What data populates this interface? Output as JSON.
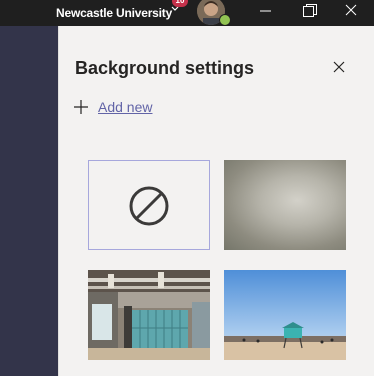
{
  "titlebar": {
    "org_name": "Newcastle University",
    "notification_count": "10",
    "presence_status": "available"
  },
  "panel": {
    "title": "Background settings",
    "add_new_label": "Add new"
  },
  "backgrounds": [
    {
      "name": "None"
    },
    {
      "name": "Blur"
    },
    {
      "name": "Office corridor"
    },
    {
      "name": "Beach lifeguard tower"
    }
  ],
  "colors": {
    "accent": "#6264a7",
    "selected_border": "#a6a7dc",
    "titlebar": "#1f1f1f",
    "app_bar": "#33344a",
    "badge": "#c4314b",
    "presence": "#92c353"
  },
  "icons": {
    "add": "plus-icon",
    "close": "close-icon",
    "none": "no-background-icon",
    "chevron": "chevron-down-icon"
  }
}
